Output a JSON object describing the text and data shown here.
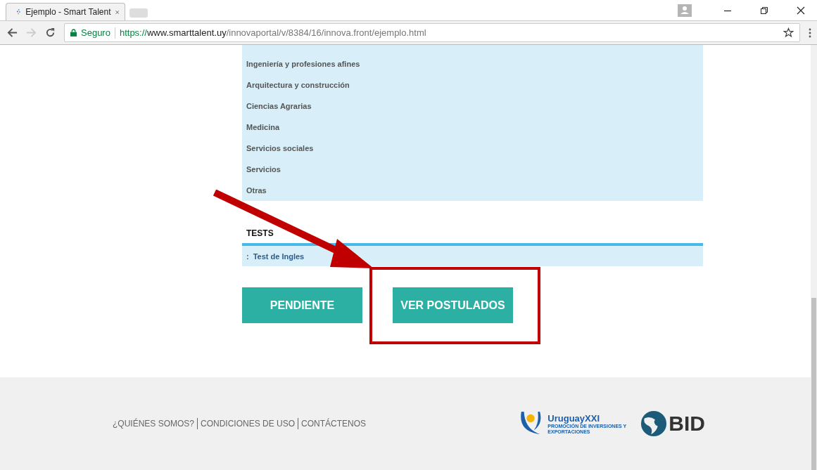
{
  "browser": {
    "tab_title": "Ejemplo - Smart Talent",
    "security_label": "Seguro",
    "url_scheme": "https://",
    "url_host": "www.smarttalent.uy",
    "url_path": "/innovaportal/v/8384/16/innova.front/ejemplo.html"
  },
  "categories": [
    "Ingeniería y profesiones afines",
    "Arquitectura y construcción",
    "Ciencias Agrarias",
    "Medicina",
    "Servicios sociales",
    "Servicios",
    "Otras"
  ],
  "tests": {
    "heading": "TESTS",
    "items": [
      {
        "bullet": ":",
        "label": "Test de Ingles"
      }
    ]
  },
  "buttons": [
    "PENDIENTE",
    "VER POSTULADOS"
  ],
  "footer": {
    "links": [
      "¿QUIÉNES SOMOS?",
      "CONDICIONES DE USO",
      "CONTÁCTENOS"
    ],
    "uruguay_logo": "UruguayXXI",
    "uruguay_tagline": "PROMOCIÓN DE INVERSIONES Y EXPORTACIONES",
    "bid_logo": "BID"
  }
}
